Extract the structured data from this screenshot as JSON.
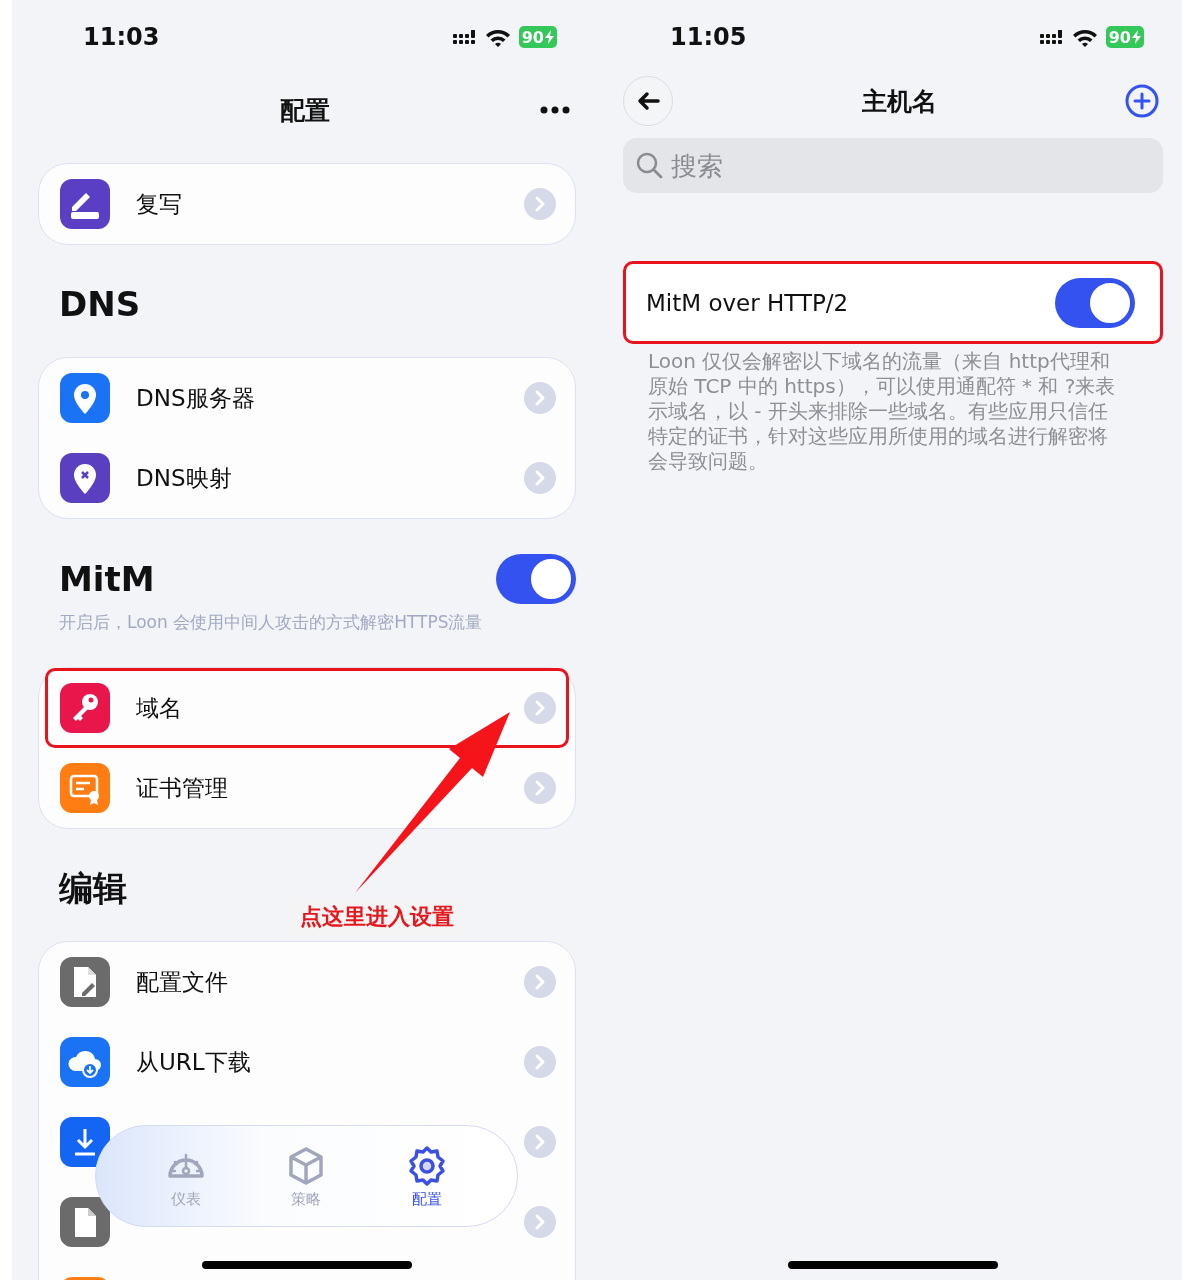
{
  "left_screen": {
    "status_bar": {
      "time": "11:03",
      "battery": "90"
    },
    "nav": {
      "title": "配置"
    },
    "sections": [
      {
        "items": [
          {
            "kind": "full",
            "label": "复写",
            "highlighted": false
          }
        ]
      },
      {
        "heading": "DNS",
        "items": [
          {
            "kind": "full",
            "label": "DNS服务器",
            "highlighted": false
          },
          {
            "kind": "full",
            "label": "DNS映射",
            "highlighted": false
          }
        ]
      },
      {
        "heading": "MitM",
        "toggle": {
          "on": true
        },
        "subtitle": "开启后，Loon 会使用中间人攻击的方式解密HTTPS流量",
        "items": [
          {
            "kind": "full",
            "label": "域名",
            "highlighted": true
          },
          {
            "kind": "full",
            "label": "证书管理",
            "highlighted": false
          }
        ]
      },
      {
        "heading": "编辑",
        "items": [
          {
            "kind": "full",
            "label": "配置文件",
            "highlighted": false
          },
          {
            "kind": "full",
            "label": "从URL下载",
            "highlighted": false
          },
          {
            "kind": "covered"
          },
          {
            "kind": "covered"
          },
          {
            "kind": "covered"
          }
        ]
      }
    ],
    "tab_bar": [
      {
        "label": "仪表",
        "selected": false
      },
      {
        "label": "策略",
        "selected": false
      },
      {
        "label": "配置",
        "selected": true
      }
    ],
    "callout": {
      "text": "点这里进入设置"
    }
  },
  "right_screen": {
    "status_bar": {
      "time": "11:05",
      "battery": "90"
    },
    "nav": {
      "title": "主机名"
    },
    "search": {
      "placeholder": "搜索"
    },
    "settings": [
      {
        "label": "MitM over HTTP/2",
        "on": true,
        "highlighted": true
      }
    ],
    "footnote": "Loon 仅仅会解密以下域名的流量（来自 http代理和原始 TCP 中的 https），可以使用通配符 * 和 ?来表示域名，以 - 开头来排除一些域名。有些应用只信任特定的证书，针对这些应用所使用的域名进行解密将会导致问题。"
  }
}
